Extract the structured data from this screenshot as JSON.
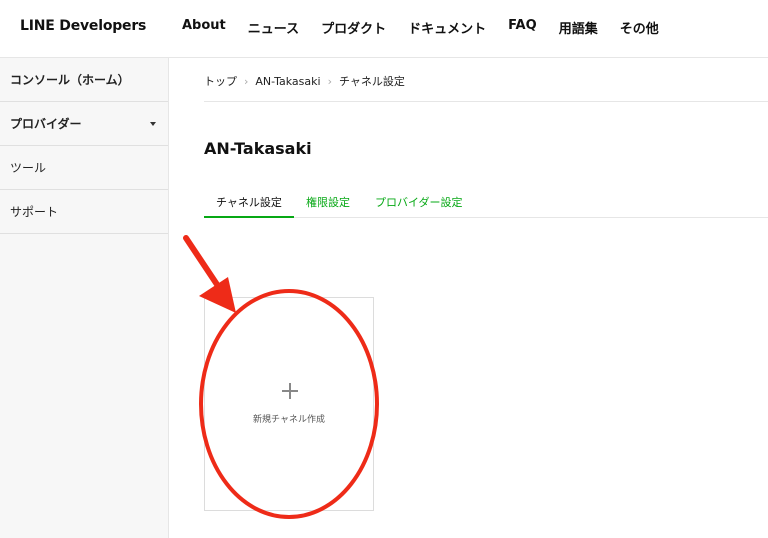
{
  "header": {
    "logo": "LINE Developers",
    "nav": [
      "About",
      "ニュース",
      "プロダクト",
      "ドキュメント",
      "FAQ",
      "用語集",
      "その他"
    ]
  },
  "sidebar": {
    "items": [
      {
        "label": "コンソール（ホーム）"
      },
      {
        "label": "プロバイダー"
      },
      {
        "label": "ツール"
      },
      {
        "label": "サポート"
      }
    ]
  },
  "breadcrumb": [
    "トップ",
    "AN-Takasaki",
    "チャネル設定"
  ],
  "main": {
    "title": "AN-Takasaki",
    "tabs": [
      {
        "label": "チャネル設定"
      },
      {
        "label": "権限設定"
      },
      {
        "label": "プロバイダー設定"
      }
    ],
    "new_channel_label": "新規チャネル作成"
  },
  "colors": {
    "accent": "#06a814",
    "annotation": "#ee2b18"
  },
  "icons": {
    "plus": "plus-icon",
    "caret": "chevron-down-icon",
    "annotation_arrow": "arrow-icon",
    "annotation_ellipse": "highlight-circle"
  }
}
